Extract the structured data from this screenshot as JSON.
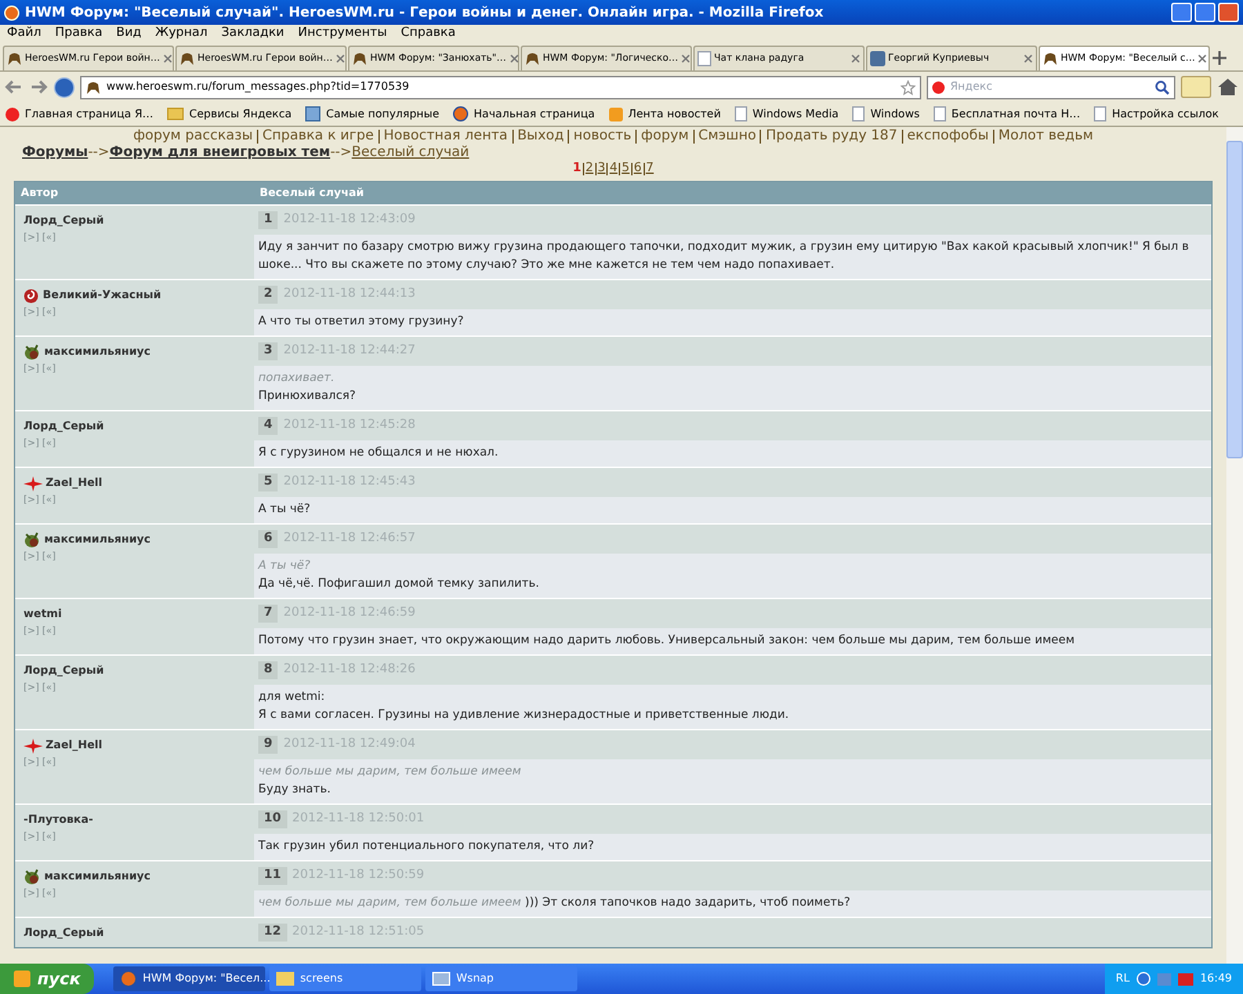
{
  "window": {
    "title": "HWM Форум: \"Веселый случай\". HeroesWM.ru - Герои войны и денег. Онлайн игра. - Mozilla Firefox"
  },
  "menu": [
    "Файл",
    "Правка",
    "Вид",
    "Журнал",
    "Закладки",
    "Инструменты",
    "Справка"
  ],
  "tabs": [
    {
      "label": "HeroesWM.ru Герои войн…",
      "selected": false,
      "kind": "site"
    },
    {
      "label": "HeroesWM.ru Герои войн…",
      "selected": false,
      "kind": "site"
    },
    {
      "label": "HWM Форум: \"Занюхать\"…",
      "selected": false,
      "kind": "site"
    },
    {
      "label": "HWM Форум: \"Логическо…",
      "selected": false,
      "kind": "site"
    },
    {
      "label": "Чат клана радуга",
      "selected": false,
      "kind": "blank"
    },
    {
      "label": "Георгий Куприевыч",
      "selected": false,
      "kind": "social"
    },
    {
      "label": "HWM Форум: \"Веселый с…",
      "selected": true,
      "kind": "site"
    }
  ],
  "address": {
    "value": "www.heroeswm.ru/forum_messages.php?tid=1770539"
  },
  "search": {
    "placeholder": "Яндекс"
  },
  "bookmarks": [
    {
      "label": "Главная страница Я…",
      "kind": "yandex"
    },
    {
      "label": "Сервисы Яндекса",
      "kind": "folder"
    },
    {
      "label": "Самые популярные",
      "kind": "star"
    },
    {
      "label": "Начальная страница",
      "kind": "firefox"
    },
    {
      "label": "Лента новостей",
      "kind": "rss"
    },
    {
      "label": "Windows Media",
      "kind": "page"
    },
    {
      "label": "Windows",
      "kind": "page"
    },
    {
      "label": "Бесплатная почта Н…",
      "kind": "page"
    },
    {
      "label": "Настройка ссылок",
      "kind": "page"
    }
  ],
  "top_links": [
    "форум рассказы",
    "Справка к игре",
    "Новостная лента",
    "Выход",
    "новость",
    "форум",
    "Смэшно",
    "Продать руду 187",
    "експофобы",
    "Молот ведьм"
  ],
  "breadcrumb": [
    {
      "label": "Форумы",
      "kind": "section"
    },
    {
      "label": "-->",
      "kind": "arrow"
    },
    {
      "label": "Форум для внеигровых тем",
      "kind": "section"
    },
    {
      "label": "-->",
      "kind": "arrow"
    },
    {
      "label": "Веселый случай",
      "kind": "current"
    }
  ],
  "pages": [
    {
      "label": "1",
      "selected": true
    },
    {
      "label": "2",
      "selected": false
    },
    {
      "label": "3",
      "selected": false
    },
    {
      "label": "4",
      "selected": false
    },
    {
      "label": "5",
      "selected": false
    },
    {
      "label": "6",
      "selected": false
    },
    {
      "label": "7",
      "selected": false
    }
  ],
  "table": {
    "columns": [
      "Автор",
      "Веселый случай"
    ],
    "posts": [
      {
        "author": "Лорд_Серый",
        "kind": "none",
        "links": "[>] [«]",
        "number": "1",
        "date": "2012-11-18 12:43:09",
        "body": [
          [
            {
              "kind": "text",
              "text": "Иду я занчит по базару смотрю вижу грузина продающего тапочки, подходит мужик, а грузин ему цитирую \"Вах какой красывый хлопчик!\" Я был в шоке... Что вы скажете по этому случаю? Это же мне кажется не тем чем надо попахивает."
            }
          ]
        ]
      },
      {
        "author": "Великий-Ужасный",
        "kind": "spiral",
        "links": "[>] [«]",
        "number": "2",
        "date": "2012-11-18 12:44:13",
        "body": [
          [
            {
              "kind": "text",
              "text": "А что ты ответил этому грузину?"
            }
          ]
        ]
      },
      {
        "author": "максимильяниус",
        "kind": "beast",
        "links": "[>] [«]",
        "number": "3",
        "date": "2012-11-18 12:44:27",
        "body": [
          [
            {
              "kind": "quote",
              "text": "попахивает."
            }
          ],
          [
            {
              "kind": "text",
              "text": "Принюхивался?"
            }
          ]
        ]
      },
      {
        "author": "Лорд_Серый",
        "kind": "none",
        "links": "[>] [«]",
        "number": "4",
        "date": "2012-11-18 12:45:28",
        "body": [
          [
            {
              "kind": "text",
              "text": "Я с гурузином не общался и не нюхал."
            }
          ]
        ]
      },
      {
        "author": "Zael_Hell",
        "kind": "cross",
        "links": "[>] [«]",
        "number": "5",
        "date": "2012-11-18 12:45:43",
        "body": [
          [
            {
              "kind": "text",
              "text": "А ты чё?"
            }
          ]
        ]
      },
      {
        "author": "максимильяниус",
        "kind": "beast",
        "links": "[>] [«]",
        "number": "6",
        "date": "2012-11-18 12:46:57",
        "body": [
          [
            {
              "kind": "quote",
              "text": "А ты чё?"
            }
          ],
          [
            {
              "kind": "text",
              "text": "Да чё,чё. Пофигашил домой темку запилить."
            }
          ]
        ]
      },
      {
        "author": "wetmi",
        "kind": "none",
        "links": "[>] [«]",
        "number": "7",
        "date": "2012-11-18 12:46:59",
        "body": [
          [
            {
              "kind": "text",
              "text": "Потому что грузин знает, что окружающим надо дарить любовь. Универсальный закон: чем больше мы дарим, тем больше имеем"
            }
          ]
        ]
      },
      {
        "author": "Лорд_Серый",
        "kind": "none",
        "links": "[>] [«]",
        "number": "8",
        "date": "2012-11-18 12:48:26",
        "body": [
          [
            {
              "kind": "text",
              "text": "для wetmi:"
            }
          ],
          [
            {
              "kind": "text",
              "text": "Я с вами согласен. Грузины на удивление жизнерадостные и приветственные люди."
            }
          ]
        ]
      },
      {
        "author": "Zael_Hell",
        "kind": "cross",
        "links": "[>] [«]",
        "number": "9",
        "date": "2012-11-18 12:49:04",
        "body": [
          [
            {
              "kind": "quote",
              "text": "чем больше мы дарим, тем больше имеем"
            }
          ],
          [
            {
              "kind": "text",
              "text": "Буду знать."
            }
          ]
        ]
      },
      {
        "author": "-Плутовка-",
        "kind": "none",
        "links": "[>] [«]",
        "number": "10",
        "date": "2012-11-18 12:50:01",
        "body": [
          [
            {
              "kind": "text",
              "text": "Так грузин убил потенциального покупателя, что ли?"
            }
          ]
        ]
      },
      {
        "author": "максимильяниус",
        "kind": "beast",
        "links": "[>] [«]",
        "number": "11",
        "date": "2012-11-18 12:50:59",
        "body": [
          [
            {
              "kind": "quote",
              "text": "чем больше мы дарим, тем больше имеем"
            },
            {
              "kind": "text",
              "text": " ))) Эт сколя тапочков надо задарить, чтоб поиметь?"
            }
          ]
        ]
      },
      {
        "author": "Лорд_Серый",
        "kind": "none",
        "number": "12",
        "date": "2012-11-18 12:51:05"
      }
    ]
  },
  "taskbar": {
    "start": "пуск",
    "tasks": [
      {
        "label": "HWM Форум: \"Весел...",
        "kind": "firefox",
        "selected": true
      },
      {
        "label": "screens",
        "kind": "folder",
        "selected": false
      },
      {
        "label": "Wsnap",
        "kind": "app",
        "selected": false
      }
    ],
    "tray": {
      "language": "RL",
      "time": "16:49"
    }
  }
}
